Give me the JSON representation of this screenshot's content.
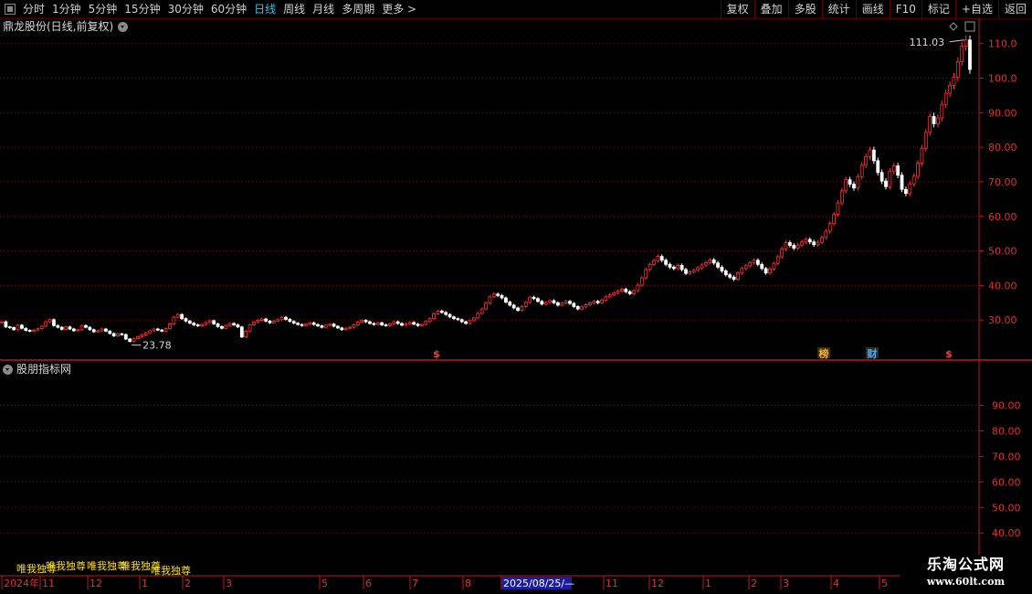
{
  "toolbar": {
    "periods": [
      "分时",
      "1分钟",
      "5分钟",
      "15分钟",
      "30分钟",
      "60分钟",
      "日线",
      "周线",
      "月线",
      "多周期",
      "更多 >"
    ],
    "active": "日线",
    "buttons": [
      "复权",
      "叠加",
      "多股",
      "统计",
      "画线",
      "F10",
      "标记",
      "+自选",
      "返回"
    ]
  },
  "main_chart": {
    "title": "鼎龙股份(日线,前复权)",
    "max_label": "111.03",
    "min_label": "23.78",
    "badges": [
      {
        "text": "$",
        "color": "#ff3b3b"
      },
      {
        "text": "榜",
        "color": "#ffb020"
      },
      {
        "text": "财",
        "color": "#4aa8ff"
      },
      {
        "text": "$",
        "color": "#ff3b3b"
      }
    ]
  },
  "indicator": {
    "title": "股朋指标网",
    "signal_text": "唯我独尊"
  },
  "timeline": {
    "labels": [
      "2024年",
      "11",
      "12",
      "1",
      "2",
      "3",
      "5",
      "6",
      "7",
      "8",
      "2025/08/25/—",
      "11",
      "12",
      "1",
      "2",
      "3",
      "4",
      "5"
    ],
    "cursor_label": "2025/08/25/—"
  },
  "watermark": {
    "title": "乐淘公式网",
    "url": "www.60lt.com"
  },
  "chart_data": [
    {
      "type": "candlestick",
      "title": "鼎龙股份(日线,前复权)",
      "y_ticks": [
        "30.00",
        "40.00",
        "50.00",
        "60.00",
        "70.00",
        "80.00",
        "90.00",
        "100.0",
        "110.0"
      ],
      "ylim": [
        20,
        116
      ],
      "grid": true,
      "series": [
        {
          "values": [
            29.5,
            28.0,
            27.8,
            27.2,
            28.5,
            27.6,
            27.0,
            26.8,
            27.1,
            27.5,
            28.2,
            29.5,
            30.1,
            28.4,
            27.9,
            27.3,
            28.0,
            27.4,
            26.9,
            27.2,
            28.4,
            27.9,
            27.2,
            26.6,
            26.9,
            27.4,
            26.8,
            26.1,
            25.4,
            26.0,
            25.8,
            24.5,
            23.8,
            24.6,
            25.2,
            25.7,
            26.3,
            26.9,
            27.4,
            27.1,
            26.8,
            27.5,
            28.9,
            30.8,
            31.6,
            30.4,
            29.7,
            29.1,
            28.6,
            28.3,
            28.7,
            29.3,
            29.8,
            28.9,
            28.1,
            27.6,
            28.4,
            29.0,
            28.6,
            28.0,
            25.1,
            26.8,
            28.6,
            29.4,
            29.9,
            30.3,
            29.7,
            29.2,
            29.7,
            30.1,
            30.8,
            30.2,
            29.6,
            29.1,
            28.7,
            28.4,
            28.8,
            29.2,
            28.7,
            28.3,
            27.9,
            28.5,
            28.8,
            28.2,
            27.7,
            27.2,
            27.6,
            27.9,
            28.6,
            29.4,
            29.9,
            29.5,
            29.0,
            28.7,
            29.2,
            28.6,
            28.4,
            28.9,
            29.5,
            29.0,
            28.5,
            28.9,
            29.3,
            28.8,
            28.4,
            28.7,
            29.6,
            30.4,
            31.8,
            32.6,
            32.2,
            31.6,
            30.9,
            30.4,
            30.1,
            29.5,
            29.0,
            29.8,
            30.6,
            31.9,
            33.2,
            34.9,
            36.7,
            37.5,
            37.1,
            36.4,
            35.2,
            34.3,
            33.5,
            32.8,
            33.9,
            35.1,
            36.6,
            36.2,
            35.4,
            34.6,
            35.1,
            35.6,
            35.0,
            34.3,
            34.9,
            35.4,
            34.8,
            33.9,
            33.2,
            33.8,
            34.4,
            34.9,
            35.4,
            35.0,
            35.8,
            36.7,
            37.3,
            37.9,
            38.4,
            38.9,
            38.2,
            37.6,
            38.5,
            40.1,
            42.2,
            44.6,
            46.1,
            47.2,
            48.4,
            47.3,
            46.1,
            45.3,
            44.9,
            45.8,
            44.6,
            43.5,
            43.9,
            44.4,
            45.1,
            45.9,
            46.6,
            47.4,
            46.5,
            45.3,
            44.2,
            43.1,
            42.4,
            41.8,
            43.6,
            44.9,
            45.7,
            46.6,
            47.3,
            46.1,
            44.9,
            43.6,
            44.8,
            46.4,
            48.3,
            50.6,
            52.4,
            51.6,
            50.8,
            51.7,
            52.6,
            53.3,
            52.6,
            51.8,
            52.5,
            53.9,
            55.7,
            57.9,
            60.6,
            63.9,
            67.4,
            70.6,
            69.3,
            68.2,
            71.5,
            74.8,
            77.3,
            79.2,
            76.1,
            72.7,
            70.2,
            68.6,
            73.1,
            74.6,
            71.9,
            67.8,
            66.6,
            69.4,
            71.6,
            75.4,
            79.7,
            84.3,
            88.9,
            86.8,
            88.5,
            92.4,
            95.6,
            97.9,
            100.3,
            104.8,
            109.2,
            111.03,
            102.5
          ]
        }
      ]
    },
    {
      "type": "line",
      "title": "股朋指标网",
      "y_ticks": [
        "40.00",
        "50.00",
        "60.00",
        "70.00",
        "80.00",
        "90.00"
      ],
      "ylim": [
        34,
        102
      ]
    }
  ]
}
